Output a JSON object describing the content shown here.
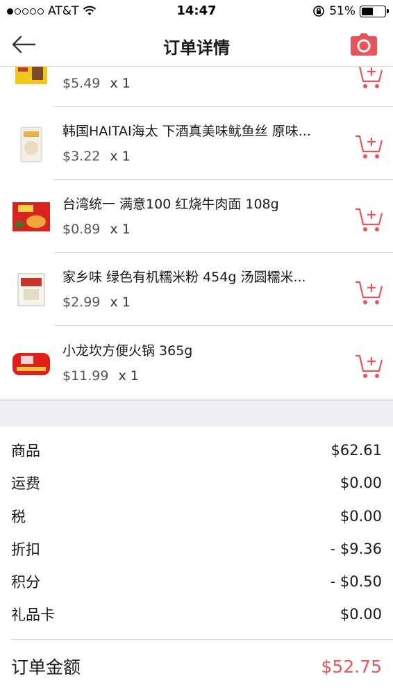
{
  "status_bar": {
    "carrier": "AT&T",
    "time": "14:47",
    "battery": "51%",
    "battery_level": 0.51,
    "signal_bars": 1
  },
  "header": {
    "title": "订单详情",
    "back_icon": "back-arrow-icon",
    "camera_icon": "camera-icon"
  },
  "colors": {
    "accent": "#e9535a",
    "background_gray": "#efeff4"
  },
  "products": [
    {
      "name": "",
      "price": "$5.49",
      "qty": "x 1"
    },
    {
      "name": "韩国HAITAI海太 下酒真美味鱿鱼丝 原味...",
      "price": "$3.22",
      "qty": "x 1"
    },
    {
      "name": "台湾统一 满意100 红烧牛肉面 108g",
      "price": "$0.89",
      "qty": "x 1"
    },
    {
      "name": "家乡味 绿色有机糯米粉 454g 汤圆糯米...",
      "price": "$2.99",
      "qty": "x 1"
    },
    {
      "name": "小龙坎方便火锅 365g",
      "price": "$11.99",
      "qty": "x 1"
    }
  ],
  "summary": [
    {
      "label": "商品",
      "value": "$62.61"
    },
    {
      "label": "运费",
      "value": "$0.00"
    },
    {
      "label": "税",
      "value": "$0.00"
    },
    {
      "label": "折扣",
      "value": "- $9.36"
    },
    {
      "label": "积分",
      "value": "- $0.50"
    },
    {
      "label": "礼品卡",
      "value": "$0.00"
    }
  ],
  "total": {
    "label": "订单金额",
    "value": "$52.75"
  }
}
